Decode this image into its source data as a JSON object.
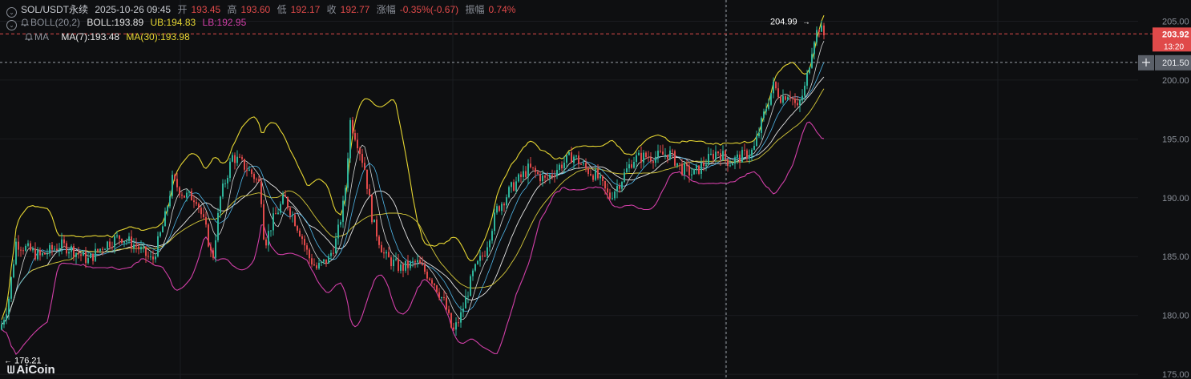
{
  "header": {
    "symbol": "SOL/USDT永续",
    "datetime": "2025-10-26 09:45",
    "open_label": "开",
    "open": "193.45",
    "high_label": "高",
    "high": "193.60",
    "low_label": "低",
    "low": "192.17",
    "close_label": "收",
    "close": "192.77",
    "change_label": "涨幅",
    "change": "-0.35%(-0.67)",
    "amp_label": "振幅",
    "amp": "0.74%"
  },
  "boll": {
    "name": "BOLL(20,2)",
    "mid": "BOLL:193.89",
    "ub": "UB:194.83",
    "lb": "LB:192.95"
  },
  "ma": {
    "name": "MA",
    "ma7": "MA(7):193.48",
    "ma30": "MA(30):193.98"
  },
  "logo": {
    "text": "AiCoin"
  },
  "colors": {
    "background": "#0e0f11",
    "up": "#2eb39a",
    "down": "#e04a4a",
    "ub": "#e6d632",
    "lb": "#d23fa8",
    "mid": "#e6e6e6",
    "ma7": "#d8d8d8",
    "ma30": "#d6c93a",
    "price_badge": "#e04a4a",
    "cross_badge": "#5a5f68"
  },
  "chart_data": {
    "type": "candlestick",
    "y_axis": {
      "ylim": [
        174.6,
        206.8
      ],
      "ticks": [
        "205.00",
        "200.00",
        "195.00",
        "190.00",
        "185.00",
        "180.00",
        "175.00"
      ],
      "tick_values": [
        205,
        200,
        195,
        190,
        185,
        180,
        175
      ]
    },
    "annotations": {
      "high_marker": {
        "label": "204.99",
        "value": 204.99
      },
      "low_marker": {
        "label": "176.21",
        "value": 176.21
      },
      "last_price": {
        "label": "203.92",
        "value": 203.92,
        "countdown": "13:20"
      },
      "crosshair_price": {
        "label": "201.50",
        "value": 201.5
      }
    },
    "grid": true,
    "waypoints": [
      [
        0,
        178.8
      ],
      [
        10,
        181.0
      ],
      [
        20,
        186.2
      ],
      [
        50,
        185.0
      ],
      [
        75,
        186.0
      ],
      [
        90,
        185.6
      ],
      [
        110,
        184.7
      ],
      [
        130,
        186.0
      ],
      [
        150,
        186.7
      ],
      [
        170,
        185.9
      ],
      [
        190,
        184.6
      ],
      [
        205,
        188.0
      ],
      [
        215,
        191.5
      ],
      [
        230,
        190.2
      ],
      [
        245,
        190.0
      ],
      [
        258,
        187.0
      ],
      [
        265,
        184.6
      ],
      [
        275,
        190.0
      ],
      [
        290,
        193.5
      ],
      [
        300,
        193.0
      ],
      [
        315,
        192.0
      ],
      [
        325,
        191.0
      ],
      [
        330,
        186.0
      ],
      [
        340,
        188.0
      ],
      [
        355,
        190.0
      ],
      [
        375,
        187.0
      ],
      [
        385,
        185.0
      ],
      [
        395,
        184.0
      ],
      [
        410,
        184.8
      ],
      [
        420,
        186.5
      ],
      [
        430,
        190.0
      ],
      [
        437,
        196.5
      ],
      [
        445,
        195.0
      ],
      [
        455,
        192.5
      ],
      [
        465,
        188.0
      ],
      [
        480,
        185.0
      ],
      [
        500,
        184.0
      ],
      [
        520,
        184.5
      ],
      [
        540,
        183.0
      ],
      [
        555,
        181.0
      ],
      [
        565,
        178.5
      ],
      [
        575,
        180.0
      ],
      [
        590,
        183.5
      ],
      [
        605,
        185.5
      ],
      [
        620,
        189.0
      ],
      [
        640,
        191.0
      ],
      [
        660,
        192.5
      ],
      [
        680,
        191.5
      ],
      [
        700,
        192.8
      ],
      [
        715,
        193.6
      ],
      [
        730,
        192.5
      ],
      [
        745,
        191.8
      ],
      [
        760,
        190.0
      ],
      [
        775,
        191.5
      ],
      [
        790,
        193.3
      ],
      [
        805,
        193.5
      ],
      [
        820,
        193.5
      ],
      [
        835,
        193.8
      ],
      [
        850,
        192.5
      ],
      [
        865,
        192.0
      ],
      [
        880,
        193.0
      ],
      [
        895,
        194.0
      ],
      [
        910,
        193.0
      ],
      [
        925,
        193.5
      ],
      [
        940,
        194.0
      ],
      [
        955,
        197.5
      ],
      [
        965,
        199.5
      ],
      [
        975,
        198.5
      ],
      [
        985,
        199.0
      ],
      [
        995,
        197.5
      ],
      [
        1005,
        199.5
      ],
      [
        1015,
        203.5
      ],
      [
        1022,
        204.5
      ],
      [
        1030,
        203.6
      ]
    ]
  }
}
